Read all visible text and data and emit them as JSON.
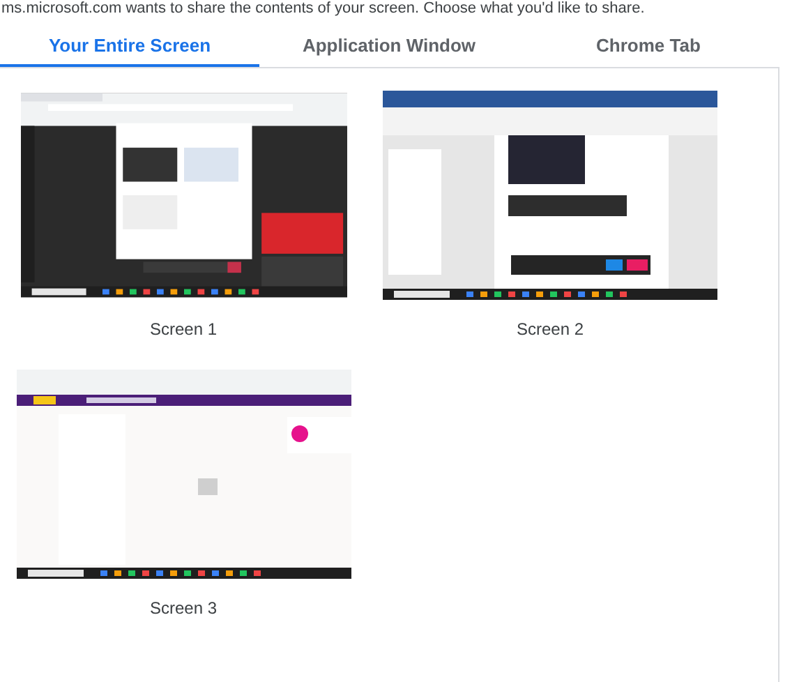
{
  "prompt": "ms.microsoft.com wants to share the contents of your screen. Choose what you'd like to share.",
  "tabs": [
    {
      "label": "Your Entire Screen",
      "selected": true
    },
    {
      "label": "Application Window",
      "selected": false
    },
    {
      "label": "Chrome Tab",
      "selected": false
    }
  ],
  "sources": [
    {
      "label": "Screen 1",
      "kind": "meeting"
    },
    {
      "label": "Screen 2",
      "kind": "document"
    },
    {
      "label": "Screen 3",
      "kind": "mail"
    }
  ]
}
